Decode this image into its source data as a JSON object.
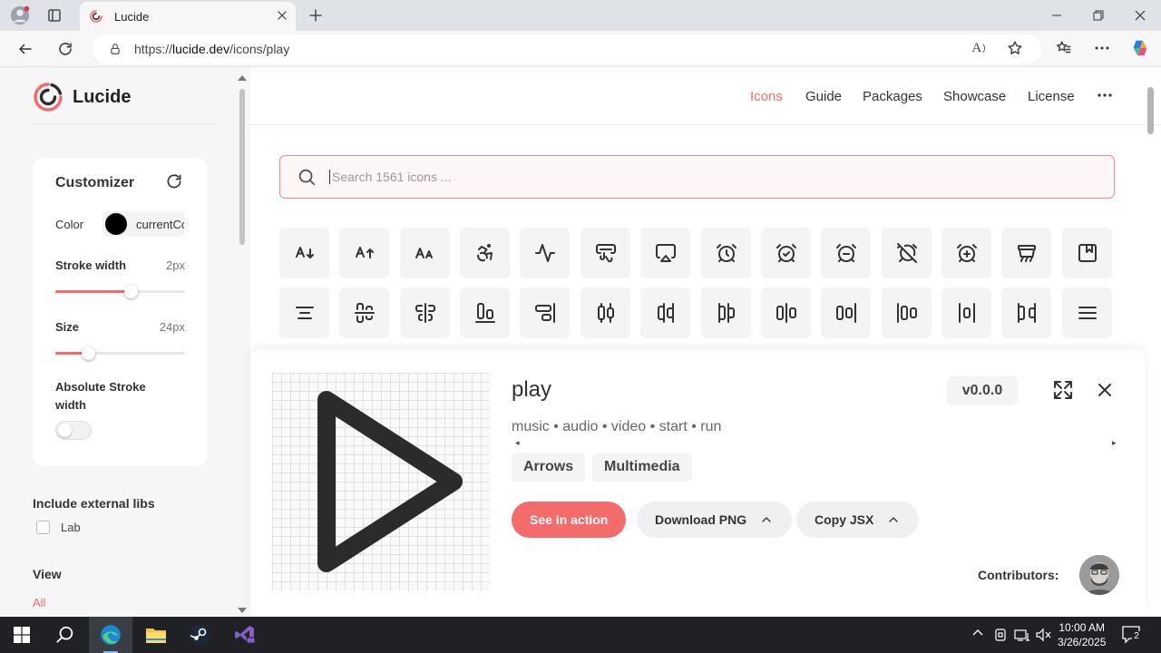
{
  "browser": {
    "tab_title": "Lucide",
    "url_prefix": "https://",
    "url_host": "lucide.dev",
    "url_path": "/icons/play",
    "read_aloud_label": "A",
    "new_tab": "+",
    "minimize": "─",
    "restore": "⧉",
    "close": "✕"
  },
  "sidebar": {
    "brand": "Lucide",
    "customizer": {
      "title": "Customizer",
      "color_label": "Color",
      "color_value": "currentColor",
      "stroke_label": "Stroke width",
      "stroke_value": "2px",
      "stroke_level": 0.58,
      "size_label": "Size",
      "size_value": "24px",
      "size_level": 0.25,
      "absolute_label": "Absolute Stroke width",
      "absolute_on": false
    },
    "include_external": "Include external libs",
    "lab_label": "Lab",
    "view_label": "View",
    "view_all": "All"
  },
  "nav": {
    "items": [
      "Icons",
      "Guide",
      "Packages",
      "Showcase",
      "License"
    ],
    "active": "Icons"
  },
  "search": {
    "placeholder": "Search 1561 icons ..."
  },
  "grid": {
    "row1": [
      "a-arrow-down",
      "a-arrow-up",
      "a-large-small",
      "accessibility",
      "activity",
      "air-vent",
      "airplay",
      "alarm-clock",
      "alarm-clock-check",
      "alarm-clock-minus",
      "alarm-clock-off",
      "alarm-clock-plus",
      "alarm-smoke",
      "album"
    ],
    "row2": [
      "align-center",
      "align-center-horizontal",
      "align-center-vertical",
      "align-end-horizontal",
      "align-end-vertical",
      "align-horizontal-distribute-center",
      "align-horizontal-distribute-end",
      "align-horizontal-distribute-start",
      "align-horizontal-justify-center",
      "align-horizontal-justify-end",
      "align-horizontal-justify-start",
      "align-horizontal-space-around",
      "align-horizontal-space-between",
      "align-justify"
    ]
  },
  "detail": {
    "name": "play",
    "tags": "music • audio • video • start • run",
    "categories": [
      "Arrows",
      "Multimedia"
    ],
    "version": "v0.0.0",
    "see_in_action": "See in action",
    "download_png": "Download PNG",
    "copy_jsx": "Copy JSX",
    "contributors_label": "Contributors:"
  },
  "taskbar": {
    "time": "10:00 AM",
    "date": "3/26/2025",
    "notifications": "2"
  },
  "colors": {
    "accent": "#f26b6b",
    "sidebar_bg": "#f6f6f7",
    "taskbar_bg": "#1f2124"
  }
}
